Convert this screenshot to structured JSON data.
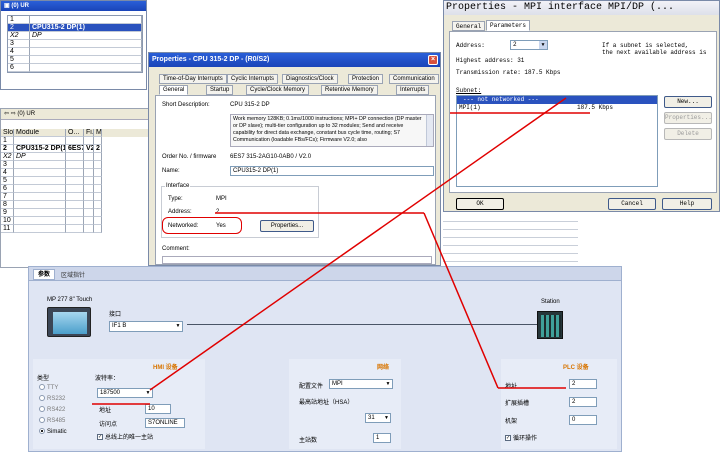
{
  "hw_config": {
    "top_title": "(0) UR",
    "rows": [
      {
        "slot": "1",
        "module": ""
      },
      {
        "slot": "2",
        "module": "CPU315-2 DP(1)"
      },
      {
        "slot": "X2",
        "module": "DP"
      },
      {
        "slot": "3",
        "module": ""
      },
      {
        "slot": "4",
        "module": ""
      },
      {
        "slot": "5",
        "module": ""
      },
      {
        "slot": "6",
        "module": ""
      }
    ],
    "nav_title": "(0)  UR",
    "table_headers": [
      "Slot",
      "Module",
      "O...",
      "Fi...",
      "M..."
    ],
    "table_rows": [
      {
        "slot": "1",
        "module": "",
        "order": "",
        "fw": "",
        "m": ""
      },
      {
        "slot": "2",
        "module": "CPU315-2 DP(1)",
        "order": "6ES7...",
        "fw": "V2.0",
        "m": "2"
      },
      {
        "slot": "X2",
        "module": "DP",
        "order": "",
        "fw": "",
        "m": ""
      },
      {
        "slot": "3",
        "module": "",
        "order": "",
        "fw": "",
        "m": ""
      },
      {
        "slot": "4",
        "module": "",
        "order": "",
        "fw": "",
        "m": ""
      },
      {
        "slot": "5",
        "module": "",
        "order": "",
        "fw": "",
        "m": ""
      },
      {
        "slot": "6",
        "module": "",
        "order": "",
        "fw": "",
        "m": ""
      },
      {
        "slot": "7",
        "module": "",
        "order": "",
        "fw": "",
        "m": ""
      },
      {
        "slot": "8",
        "module": "",
        "order": "",
        "fw": "",
        "m": ""
      },
      {
        "slot": "9",
        "module": "",
        "order": "",
        "fw": "",
        "m": ""
      },
      {
        "slot": "10",
        "module": "",
        "order": "",
        "fw": "",
        "m": ""
      },
      {
        "slot": "11",
        "module": "",
        "order": "",
        "fw": "",
        "m": ""
      }
    ]
  },
  "cpu_dialog": {
    "title": "Properties - CPU 315-2 DP - (R0/S2)",
    "tabs_row1": [
      "Time-of-Day Interrupts",
      "Cyclic Interrupts",
      "Diagnostics/Clock",
      "Protection",
      "Communication"
    ],
    "tabs_row2": [
      "General",
      "Startup",
      "Cycle/Clock Memory",
      "Retentive Memory",
      "Interrupts"
    ],
    "short_desc_label": "Short Description:",
    "short_desc_value": "CPU 315-2 DP",
    "description": "Work memory 128KB; 0.1ms/1000 instructions; MPI+ DP connection (DP master or DP slave); multi-tier configuration up to 32 modules; Send and receive capability for direct data exchange, constant bus cycle time, routing; S7 Communication (loadable FBs/FCs); Firmware V2.0; also",
    "order_label": "Order No. / firmware",
    "order_value": "6ES7 315-2AG10-0AB0 / V2.0",
    "name_label": "Name:",
    "name_value": "CPU315-2 DP(1)",
    "interface_label": "Interface",
    "type_label": "Type:",
    "type_value": "MPI",
    "address_label": "Address:",
    "address_value": "2",
    "networked_label": "Networked:",
    "networked_value": "Yes",
    "properties_btn": "Properties...",
    "comment_label": "Comment:"
  },
  "mpi_dialog": {
    "title": "Properties - MPI interface  MPI/DP (...",
    "tabs": [
      "General",
      "Parameters"
    ],
    "address_label": "Address:",
    "address_value": "2",
    "note_line1": "If a subnet is selected,",
    "note_line2": "the next available address is",
    "highest_label": "Highest address: 31",
    "rate_label": "Transmission rate: 187.5 Kbps",
    "subnet_label": "Subnet:",
    "subnet_items": [
      {
        "name": "--- not networked ---",
        "rate": ""
      },
      {
        "name": "MPI(1)",
        "rate": "187.5 Kbps"
      }
    ],
    "new_btn": "New...",
    "prop_btn": "Properties...",
    "delete_btn": "Delete",
    "ok_btn": "OK",
    "cancel_btn": "Cancel",
    "help_btn": "Help"
  },
  "wincc": {
    "tabs": [
      "参数",
      "区域指针"
    ],
    "device_name": "MP 277 8\" Touch",
    "interface_label": "接口",
    "interface_value": "IF1 B",
    "station_label": "Station",
    "hmi_section": "HMI 设备",
    "network_section": "网络",
    "plc_section": "PLC 设备",
    "type_label": "类型",
    "radio_options": [
      "TTY",
      "RS232",
      "RS422",
      "RS485",
      "Simatic"
    ],
    "baud_label": "波特率：",
    "baud_value": "187500",
    "address_label": "地址",
    "address_value": "10",
    "access_label": "访问点",
    "access_value": "S7ONLINE",
    "only_master_label": "总线上的唯一主站",
    "profile_label": "配置文件",
    "profile_value": "MPI",
    "highest_station_label": "最高站地址（HSA）",
    "highest_station_value": "31",
    "master_count_label": "主站数",
    "master_count_value": "1",
    "plc_address_label": "地址",
    "plc_address_value": "2",
    "ext_slot_label": "扩展插槽",
    "ext_slot_value": "2",
    "rack_label": "机架",
    "rack_value": "0",
    "cyclic_label": "循环操作"
  }
}
